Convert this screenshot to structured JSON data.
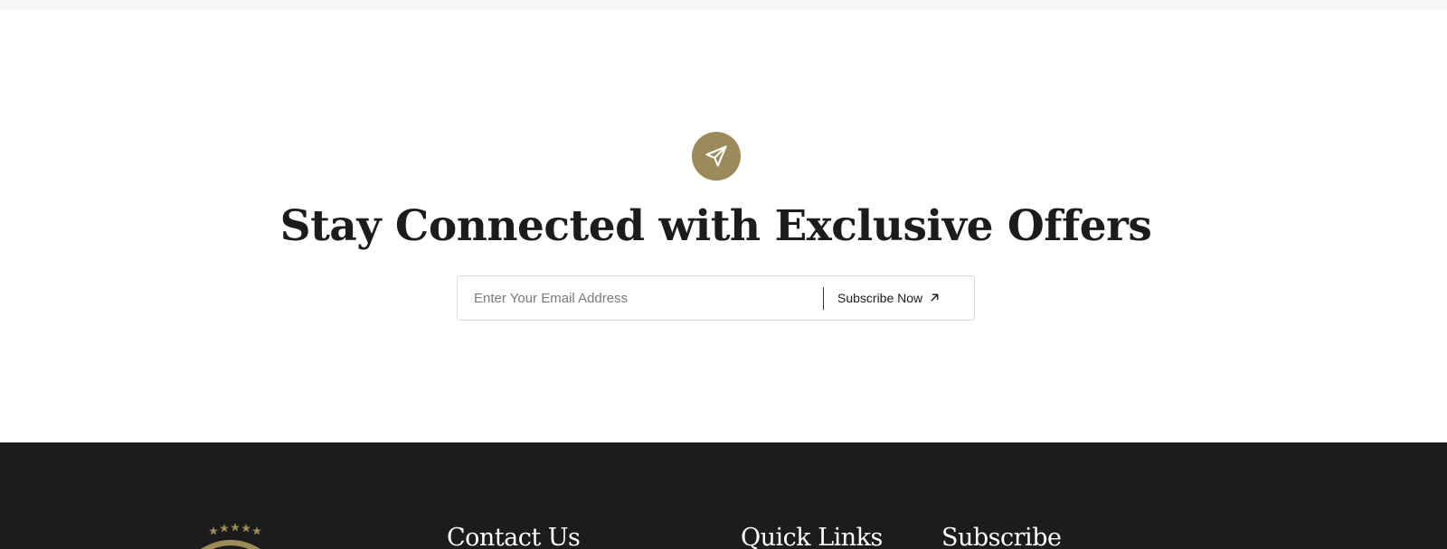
{
  "newsletter": {
    "icon": "paper-plane-icon",
    "headline": "Stay Connected with Exclusive Offers",
    "email_placeholder": "Enter Your Email Address",
    "subscribe_label": "Subscribe Now",
    "subscribe_icon": "arrow-up-right-icon"
  },
  "footer": {
    "logo_icon": "hotel-logo-icon",
    "columns": [
      {
        "heading": "Contact Us"
      },
      {
        "heading": "Quick Links"
      },
      {
        "heading": "Subscribe"
      }
    ]
  },
  "colors": {
    "accent": "#9b8a5a",
    "footer_bg": "#1c1c1c",
    "text_dark": "#1c1c1c"
  }
}
